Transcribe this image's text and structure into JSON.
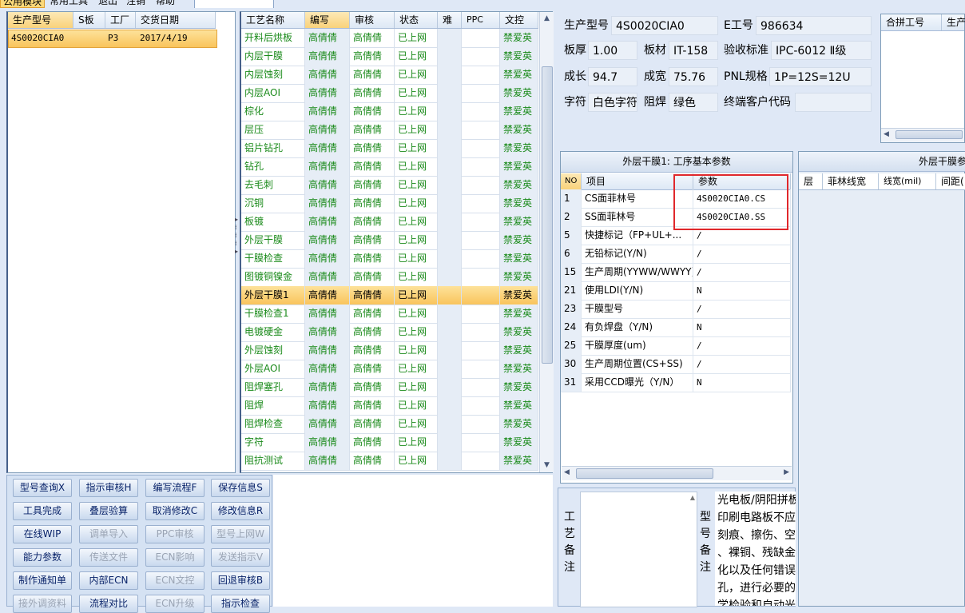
{
  "menu": {
    "items": [
      "公用模块",
      "常用工具",
      "退出",
      "注销",
      "帮助"
    ],
    "search_value": ""
  },
  "left_grid": {
    "columns": [
      "生产型号",
      "S板",
      "工厂",
      "交货日期"
    ],
    "rows": [
      {
        "model": "4S0020CIA0",
        "s_board": "",
        "factory": "P3",
        "date": "2017/4/19"
      }
    ]
  },
  "process_grid": {
    "columns": [
      "工艺名称",
      "编写",
      "审核",
      "状态",
      "难",
      "PPC",
      "文控"
    ],
    "rows": [
      {
        "name": "开料后烘板",
        "writer": "高倩倩",
        "reviewer": "高倩倩",
        "status": "已上网",
        "hard": "",
        "ppc": "",
        "doc": "禁爱英"
      },
      {
        "name": "内层干膜",
        "writer": "高倩倩",
        "reviewer": "高倩倩",
        "status": "已上网",
        "hard": "",
        "ppc": "",
        "doc": "禁爱英"
      },
      {
        "name": "内层蚀刻",
        "writer": "高倩倩",
        "reviewer": "高倩倩",
        "status": "已上网",
        "hard": "",
        "ppc": "",
        "doc": "禁爱英"
      },
      {
        "name": "内层AOI",
        "writer": "高倩倩",
        "reviewer": "高倩倩",
        "status": "已上网",
        "hard": "",
        "ppc": "",
        "doc": "禁爱英"
      },
      {
        "name": "棕化",
        "writer": "高倩倩",
        "reviewer": "高倩倩",
        "status": "已上网",
        "hard": "",
        "ppc": "",
        "doc": "禁爱英"
      },
      {
        "name": "层压",
        "writer": "高倩倩",
        "reviewer": "高倩倩",
        "status": "已上网",
        "hard": "",
        "ppc": "",
        "doc": "禁爱英"
      },
      {
        "name": "铝片钻孔",
        "writer": "高倩倩",
        "reviewer": "高倩倩",
        "status": "已上网",
        "hard": "",
        "ppc": "",
        "doc": "禁爱英"
      },
      {
        "name": "钻孔",
        "writer": "高倩倩",
        "reviewer": "高倩倩",
        "status": "已上网",
        "hard": "",
        "ppc": "",
        "doc": "禁爱英"
      },
      {
        "name": "去毛刺",
        "writer": "高倩倩",
        "reviewer": "高倩倩",
        "status": "已上网",
        "hard": "",
        "ppc": "",
        "doc": "禁爱英"
      },
      {
        "name": "沉铜",
        "writer": "高倩倩",
        "reviewer": "高倩倩",
        "status": "已上网",
        "hard": "",
        "ppc": "",
        "doc": "禁爱英"
      },
      {
        "name": "板镀",
        "writer": "高倩倩",
        "reviewer": "高倩倩",
        "status": "已上网",
        "hard": "",
        "ppc": "",
        "doc": "禁爱英"
      },
      {
        "name": "外层干膜",
        "writer": "高倩倩",
        "reviewer": "高倩倩",
        "status": "已上网",
        "hard": "",
        "ppc": "",
        "doc": "禁爱英"
      },
      {
        "name": "干膜检查",
        "writer": "高倩倩",
        "reviewer": "高倩倩",
        "status": "已上网",
        "hard": "",
        "ppc": "",
        "doc": "禁爱英"
      },
      {
        "name": "图镀铜镍金",
        "writer": "高倩倩",
        "reviewer": "高倩倩",
        "status": "已上网",
        "hard": "",
        "ppc": "",
        "doc": "禁爱英"
      },
      {
        "name": "外层干膜1",
        "writer": "高倩倩",
        "reviewer": "高倩倩",
        "status": "已上网",
        "hard": "",
        "ppc": "",
        "doc": "禁爱英",
        "selected": true
      },
      {
        "name": "干膜检查1",
        "writer": "高倩倩",
        "reviewer": "高倩倩",
        "status": "已上网",
        "hard": "",
        "ppc": "",
        "doc": "禁爱英"
      },
      {
        "name": "电镀硬金",
        "writer": "高倩倩",
        "reviewer": "高倩倩",
        "status": "已上网",
        "hard": "",
        "ppc": "",
        "doc": "禁爱英"
      },
      {
        "name": "外层蚀刻",
        "writer": "高倩倩",
        "reviewer": "高倩倩",
        "status": "已上网",
        "hard": "",
        "ppc": "",
        "doc": "禁爱英"
      },
      {
        "name": "外层AOI",
        "writer": "高倩倩",
        "reviewer": "高倩倩",
        "status": "已上网",
        "hard": "",
        "ppc": "",
        "doc": "禁爱英"
      },
      {
        "name": "阻焊塞孔",
        "writer": "高倩倩",
        "reviewer": "高倩倩",
        "status": "已上网",
        "hard": "",
        "ppc": "",
        "doc": "禁爱英"
      },
      {
        "name": "阻焊",
        "writer": "高倩倩",
        "reviewer": "高倩倩",
        "status": "已上网",
        "hard": "",
        "ppc": "",
        "doc": "禁爱英"
      },
      {
        "name": "阻焊检查",
        "writer": "高倩倩",
        "reviewer": "高倩倩",
        "status": "已上网",
        "hard": "",
        "ppc": "",
        "doc": "禁爱英"
      },
      {
        "name": "字符",
        "writer": "高倩倩",
        "reviewer": "高倩倩",
        "status": "已上网",
        "hard": "",
        "ppc": "",
        "doc": "禁爱英"
      },
      {
        "name": "阻抗测试",
        "writer": "高倩倩",
        "reviewer": "高倩倩",
        "status": "已上网",
        "hard": "",
        "ppc": "",
        "doc": "禁爱英"
      }
    ]
  },
  "buttons": [
    [
      {
        "label": "型号查询X",
        "enabled": true
      },
      {
        "label": "指示审核H",
        "enabled": true
      },
      {
        "label": "编写流程F",
        "enabled": true
      },
      {
        "label": "保存信息S",
        "enabled": true
      }
    ],
    [
      {
        "label": "工具完成",
        "enabled": true
      },
      {
        "label": "叠层验算",
        "enabled": true
      },
      {
        "label": "取消修改C",
        "enabled": true
      },
      {
        "label": "修改信息R",
        "enabled": true
      }
    ],
    [
      {
        "label": "在线WIP",
        "enabled": true
      },
      {
        "label": "调单导入",
        "enabled": false
      },
      {
        "label": "PPC审核",
        "enabled": false
      },
      {
        "label": "型号上网W",
        "enabled": false
      }
    ],
    [
      {
        "label": "能力参数",
        "enabled": true
      },
      {
        "label": "传送文件",
        "enabled": false
      },
      {
        "label": "ECN影响",
        "enabled": false
      },
      {
        "label": "发送指示V",
        "enabled": false
      }
    ],
    [
      {
        "label": "制作通知单",
        "enabled": true
      },
      {
        "label": "内部ECN",
        "enabled": true
      },
      {
        "label": "ECN文控",
        "enabled": false
      },
      {
        "label": "回退审核B",
        "enabled": true
      }
    ],
    [
      {
        "label": "接外调资料",
        "enabled": false
      },
      {
        "label": "流程对比",
        "enabled": true
      },
      {
        "label": "ECN升级",
        "enabled": false
      },
      {
        "label": "指示检查",
        "enabled": true
      }
    ]
  ],
  "info": {
    "model_label": "生产型号",
    "model": "4S0020CIA0",
    "eno_label": "E工号",
    "eno": "986634",
    "thickness_label": "板厚",
    "thickness": "1.00",
    "material_label": "板材",
    "material": "IT-158",
    "standard_label": "验收标准",
    "standard": "IPC-6012 Ⅱ级",
    "length_label": "成长",
    "length": "94.7",
    "width_label": "成宽",
    "width": "75.76",
    "pnl_label": "PNL规格",
    "pnl": "1P=12S=12U",
    "char_label": "字符",
    "char": "白色字符",
    "mask_label": "阻焊",
    "mask": "绿色",
    "customer_label": "终端客户代码",
    "customer": ""
  },
  "merge_grid": {
    "columns": [
      "合拼工号",
      "生产"
    ]
  },
  "param_grid": {
    "title": "外层干膜1: 工序基本参数",
    "columns": [
      "NO",
      "项目",
      "参数"
    ],
    "rows": [
      {
        "no": "1",
        "item": "CS面菲林号",
        "value": "4S0020CIA0.CS"
      },
      {
        "no": "2",
        "item": "SS面菲林号",
        "value": "4S0020CIA0.SS"
      },
      {
        "no": "5",
        "item": "快捷标记（FP+UL+...",
        "value": "/"
      },
      {
        "no": "6",
        "item": "无铅标记(Y/N)",
        "value": "/"
      },
      {
        "no": "15",
        "item": "生产周期(YYWW/WWYY)",
        "value": "/"
      },
      {
        "no": "21",
        "item": "使用LDI(Y/N)",
        "value": "N"
      },
      {
        "no": "23",
        "item": "干膜型号",
        "value": "/"
      },
      {
        "no": "24",
        "item": "有负焊盘（Y/N)",
        "value": "N"
      },
      {
        "no": "25",
        "item": "干膜厚度(um)",
        "value": "/"
      },
      {
        "no": "30",
        "item": "生产周期位置(CS+SS)",
        "value": "/"
      },
      {
        "no": "31",
        "item": "采用CCD曝光（Y/N）",
        "value": "N"
      }
    ]
  },
  "right_param_grid": {
    "title": "外层干膜参",
    "columns": [
      "层",
      "菲林线宽",
      "线宽(mil)",
      "间距("
    ]
  },
  "notes": {
    "process_label": [
      "工",
      "艺",
      "备",
      "注"
    ],
    "model_label": [
      "型",
      "号",
      "备",
      "注"
    ],
    "process_note": "",
    "model_note_lines": [
      "光电板/阴阳拼板",
      "印刷电路板不应",
      "刻痕、擦伤、空",
      "、裸铜、残缺金",
      "化以及任何错误",
      "孔，进行必要的",
      "学检验和自动光"
    ]
  }
}
